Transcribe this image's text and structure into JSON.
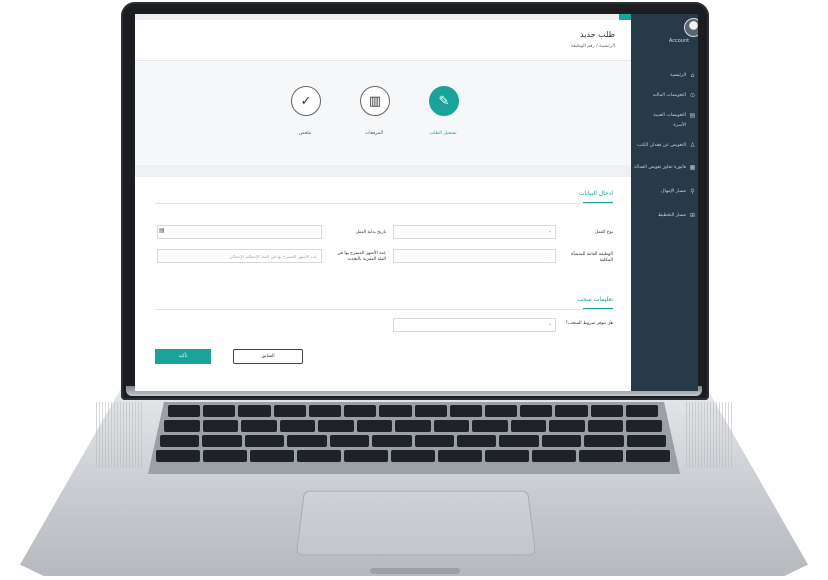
{
  "app": {
    "user_name": "Account",
    "page_title": "طلب جديد",
    "breadcrumb": "الرئيسية / رقم الوظيفة"
  },
  "sidebar": {
    "items": [
      {
        "label": "الرئيسية",
        "icon": "home-icon"
      },
      {
        "label": "التعويضات الماليه",
        "icon": "money-icon"
      },
      {
        "label": "التعويضات العينية",
        "icon": "box-icon"
      },
      {
        "label": "الأسرة",
        "icon": "family-icon"
      },
      {
        "label": "التعويض عن فقدان الكتب",
        "icon": "book-icon"
      },
      {
        "label": "فاتورة تجاوز تعويض العمالة",
        "icon": "invoice-icon"
      },
      {
        "label": "مسار الإمهال",
        "icon": "path-icon"
      },
      {
        "label": "مسار التخطيط",
        "icon": "plan-icon"
      }
    ]
  },
  "wizard": {
    "steps": [
      {
        "label": "تسجيل الطلب",
        "icon": "pencil-icon",
        "active": true
      },
      {
        "label": "المرفقات",
        "icon": "documents-icon",
        "active": false
      },
      {
        "label": "ملخص",
        "icon": "check-icon",
        "active": false
      }
    ]
  },
  "form": {
    "section1_title": "ادخال البيانات",
    "section2_title": "تعليمات سحب",
    "fields": {
      "job_type_label": "نوع العمل",
      "job_type_value": "*",
      "start_date_label": "تاريخ بداية العمل",
      "start_date_value": "",
      "company_label": "الوظيفة العامة للمنشأة المكلفة",
      "company_value": "...",
      "months_label": "عدد الأشهر المصرح بها في الفئة العمرية بالتحديد",
      "months_placeholder": "عدد الأشهر المصرح بها في الفئة الإجمالية الإجمالي",
      "condition_label": "هل تتوفر شروط السحب؟",
      "condition_value": "*"
    },
    "submit_label": "تأكيد",
    "back_label": "السابق"
  },
  "colors": {
    "accent": "#1aa39a",
    "sidebar_bg": "#273a48"
  }
}
